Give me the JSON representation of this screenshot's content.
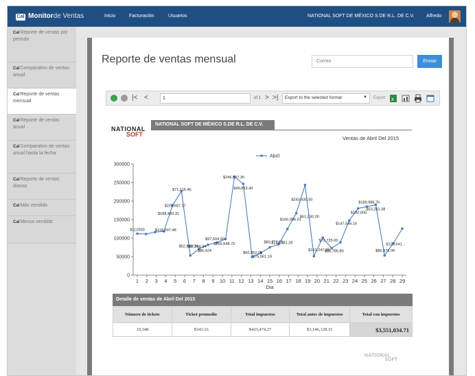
{
  "navbar": {
    "brand_strong": "Monitor",
    "brand_light": "de Ventas",
    "links": [
      "Inicio",
      "Facturación",
      "Usuarios"
    ],
    "company": "NATIONAL SOFT DE MÉXICO S.DE R.L. DE C.V.",
    "user": "Alfredo"
  },
  "sidebar": {
    "items": [
      {
        "label": "Reporte de ventas por periodo",
        "active": false
      },
      {
        "label": "Comparativo de ventas anual",
        "active": false
      },
      {
        "label": "Reporte de ventas mensual",
        "active": true
      },
      {
        "label": "Reporte de ventas anual",
        "active": false
      },
      {
        "label": "Comparativo de ventas anual hasta la fecha",
        "active": false
      },
      {
        "label": "Reporte de ventas diarias",
        "active": false
      },
      {
        "label": "Más vendido",
        "active": false
      },
      {
        "label": "Menos vendido",
        "active": false
      }
    ]
  },
  "main": {
    "title": "Reporte de ventas mensual",
    "email_placeholder": "Correo",
    "send_label": "Enviar"
  },
  "toolbar": {
    "page_value": "1",
    "of_label": "of 1",
    "export_format": "Export to the selected format",
    "export_label": "Export",
    "icons": [
      "refresh-green-icon",
      "stop-icon",
      "first-page-icon",
      "prev-page-icon",
      "next-page-icon",
      "last-page-icon",
      "excel-icon",
      "chart-icon",
      "print-icon",
      "window-icon"
    ]
  },
  "report": {
    "logo_top": "NATIONAL",
    "logo_bottom": "SOFT",
    "company_header": "NATIONAL SOFT DE MÉXICO S.DE R.L. DE C.V.",
    "subtitle": "Ventas de Abril Del 2015"
  },
  "chart_data": {
    "type": "line",
    "x": [
      1,
      2,
      3,
      4,
      5,
      6,
      7,
      8,
      9,
      10,
      11,
      12,
      13,
      14,
      15,
      16,
      17,
      18,
      19,
      20,
      21,
      22,
      23,
      24,
      25,
      26,
      27,
      28,
      29
    ],
    "series": [
      {
        "name": "Abril",
        "color": "#4a7fc1",
        "values": [
          112000,
          111000,
          116000,
          118000,
          188483.31,
          226597.27,
          53000,
          71000,
          82000,
          88000,
          97504.9,
          265548.75,
          246527.3,
          49000,
          60000,
          75000,
          83000,
          124581.28,
          166996.91,
          243430.5,
          51230.0,
          101247.38,
          72725.0,
          88785.8,
          147546.16,
          180000,
          185000,
          189988.7,
          53281.38,
          85875.0,
          125641.0
        ]
      }
    ],
    "data_labels": [
      {
        "x": 1,
        "text": "$112000"
      },
      {
        "x": 4,
        "text": "$118,297.48"
      },
      {
        "x": 4.3,
        "text": "$188,483.31"
      },
      {
        "x": 5,
        "text": "$226,597.27"
      },
      {
        "x": 5.7,
        "text": "$71,116.46"
      },
      {
        "x": 6.4,
        "text": "$52,948.74"
      },
      {
        "x": 7.3,
        "text": "$87,866.84"
      },
      {
        "x": 8.1,
        "text": "$86,424"
      },
      {
        "x": 9.2,
        "text": "$97,504.90"
      },
      {
        "x": 10.2,
        "text": "$265,548.75"
      },
      {
        "x": 11.2,
        "text": "$246,527.30"
      },
      {
        "x": 12.2,
        "text": "$49,853.40"
      },
      {
        "x": 13.2,
        "text": "$60,952.05"
      },
      {
        "x": 14.2,
        "text": "$75,061.19"
      },
      {
        "x": 15.4,
        "text": "$83,771.10"
      },
      {
        "x": 16.3,
        "text": "$124,581.28"
      },
      {
        "x": 17.2,
        "text": "$166,996.91"
      },
      {
        "x": 18.4,
        "text": "$243,430.50"
      },
      {
        "x": 19.2,
        "text": "$51,230.00"
      },
      {
        "x": 20.2,
        "text": "$101,247.38"
      },
      {
        "x": 21.2,
        "text": "$72,725.00"
      },
      {
        "x": 21.8,
        "text": "$88,785.80"
      },
      {
        "x": 23.1,
        "text": "$147,546.16"
      },
      {
        "x": 24.4,
        "text": "$180,000"
      },
      {
        "x": 25.5,
        "text": "$189,988.70"
      },
      {
        "x": 26.2,
        "text": "$53,281.38"
      },
      {
        "x": 27.2,
        "text": "$85,875.00"
      },
      {
        "x": 28.3,
        "text": "$125,641..."
      }
    ],
    "xlabel": "Dia",
    "ylabel": "",
    "ylim": [
      0,
      300000
    ],
    "yticks": [
      0,
      50000,
      100000,
      150000,
      200000,
      250000,
      300000
    ],
    "legend": "top-center",
    "grid": false
  },
  "detail": {
    "title": "Detalle de ventas de Abril Del 2015",
    "columns": [
      "Número de tickets",
      "Ticket promedio",
      "Total impuestos",
      "Total antes de impuestos",
      "Total con impuestos"
    ],
    "row": [
      "10,348",
      "$343.16",
      "$433,474.27",
      "$3,146,128.31",
      "$3,551,034.71"
    ]
  },
  "footer_logo": {
    "top": "NATIONAL",
    "bottom": "SOFT"
  }
}
